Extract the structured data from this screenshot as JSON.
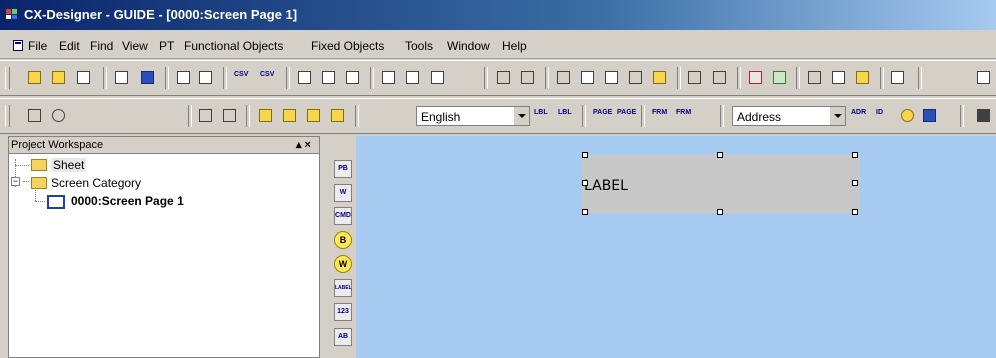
{
  "window": {
    "title": "CX-Designer - GUIDE - [0000:Screen Page 1]"
  },
  "menubar": {
    "items": [
      {
        "label": "File"
      },
      {
        "label": "Edit"
      },
      {
        "label": "Find"
      },
      {
        "label": "View"
      },
      {
        "label": "PT"
      },
      {
        "label": "Functional Objects"
      },
      {
        "label": "Fixed Objects"
      },
      {
        "label": "Tools"
      },
      {
        "label": "Window"
      },
      {
        "label": "Help"
      }
    ]
  },
  "toolbar3": {
    "language_value": "English",
    "address_value": "Address"
  },
  "toolbar_labels": {
    "csv1": "CSV",
    "csv2": "CSV",
    "lbl1": "LBL",
    "lbl2": "LBL",
    "page1": "PAGE",
    "page2": "PAGE",
    "frm1": "FRM",
    "frm2": "FRM",
    "adr": "ADR",
    "id": "ID"
  },
  "workspace": {
    "title": "Project Workspace",
    "controls": "▴ ×",
    "tree": {
      "sheet": "Sheet",
      "screen_category": "Screen Category",
      "screen_page": "0000:Screen Page 1"
    }
  },
  "object_bar": {
    "items": [
      "PB",
      "W",
      "CMD",
      "B",
      "W",
      "LABEL",
      "123",
      "AB"
    ]
  },
  "canvas": {
    "label_text": "LABEL"
  },
  "colors": {
    "title_gradient_start": "#0a246a",
    "canvas_background": "#a6caf0",
    "label_fill": "#c8c8c8"
  }
}
